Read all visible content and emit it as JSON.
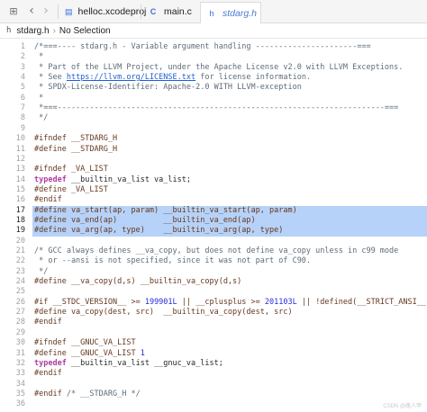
{
  "tabs": [
    {
      "label": "helloc.xcodeproj",
      "icon": "xcodeproj-icon",
      "glyph": "▤"
    },
    {
      "label": "main.c",
      "icon": "c-file-icon",
      "glyph": "C"
    },
    {
      "label": "stdarg.h",
      "icon": "h-file-icon",
      "glyph": "h",
      "active": true
    }
  ],
  "jumpbar": {
    "file": "stdarg.h",
    "file_glyph": "h",
    "item": "No Selection"
  },
  "editor": {
    "highlighted_lines": [
      17,
      18,
      19
    ],
    "current_line": 17,
    "lines": [
      {
        "n": "1",
        "tokens": [
          [
            "c",
            "/*===---- stdarg.h - Variable argument handling ----------------------==="
          ]
        ]
      },
      {
        "n": "2",
        "tokens": [
          [
            "c",
            " *"
          ]
        ]
      },
      {
        "n": "3",
        "tokens": [
          [
            "c",
            " * Part of the LLVM Project, under the Apache License v2.0 with LLVM Exceptions."
          ]
        ]
      },
      {
        "n": "4",
        "tokens": [
          [
            "c",
            " * See "
          ],
          [
            "l",
            "https://llvm.org/LICENSE.txt"
          ],
          [
            "c",
            " for license information."
          ]
        ]
      },
      {
        "n": "5",
        "tokens": [
          [
            "c",
            " * SPDX-License-Identifier: Apache-2.0 WITH LLVM-exception"
          ]
        ]
      },
      {
        "n": "6",
        "tokens": [
          [
            "c",
            " *"
          ]
        ]
      },
      {
        "n": "7",
        "tokens": [
          [
            "c",
            " *===-----------------------------------------------------------------------==="
          ]
        ]
      },
      {
        "n": "8",
        "tokens": [
          [
            "c",
            " */"
          ]
        ]
      },
      {
        "n": "9",
        "tokens": []
      },
      {
        "n": "10",
        "tokens": [
          [
            "p",
            "#ifndef __STDARG_H"
          ]
        ]
      },
      {
        "n": "11",
        "tokens": [
          [
            "p",
            "#define __STDARG_H"
          ]
        ]
      },
      {
        "n": "12",
        "tokens": []
      },
      {
        "n": "13",
        "tokens": [
          [
            "p",
            "#ifndef _VA_LIST"
          ]
        ]
      },
      {
        "n": "14",
        "tokens": [
          [
            "k",
            "typedef"
          ],
          [
            "t",
            " __builtin_va_list va_list;"
          ]
        ]
      },
      {
        "n": "15",
        "tokens": [
          [
            "p",
            "#define _VA_LIST"
          ]
        ]
      },
      {
        "n": "16",
        "tokens": [
          [
            "p",
            "#endif"
          ]
        ]
      },
      {
        "n": "17",
        "tokens": [
          [
            "p",
            "#define va_start(ap, param) __builtin_va_start(ap, param)"
          ]
        ]
      },
      {
        "n": "18",
        "tokens": [
          [
            "p",
            "#define va_end(ap)          __builtin_va_end(ap)"
          ]
        ]
      },
      {
        "n": "19",
        "tokens": [
          [
            "p",
            "#define va_arg(ap, type)    __builtin_va_arg(ap, type)"
          ]
        ]
      },
      {
        "n": "20",
        "tokens": []
      },
      {
        "n": "21",
        "tokens": [
          [
            "c",
            "/* GCC always defines __va_copy, but does not define va_copy unless in c99 mode"
          ]
        ]
      },
      {
        "n": "22",
        "tokens": [
          [
            "c",
            " * or --ansi is not specified, since it was not part of C90."
          ]
        ]
      },
      {
        "n": "23",
        "tokens": [
          [
            "c",
            " */"
          ]
        ]
      },
      {
        "n": "24",
        "tokens": [
          [
            "p",
            "#define __va_copy(d,s) __builtin_va_copy(d,s)"
          ]
        ]
      },
      {
        "n": "25",
        "tokens": []
      },
      {
        "n": "26",
        "tokens": [
          [
            "p",
            "#if __STDC_VERSION__ >= "
          ],
          [
            "n",
            "199901L"
          ],
          [
            "p",
            " || __cplusplus >= "
          ],
          [
            "n",
            "201103L"
          ],
          [
            "p",
            " || !defined(__STRICT_ANSI__)"
          ]
        ]
      },
      {
        "n": "27",
        "tokens": [
          [
            "p",
            "#define va_copy(dest, src)  __builtin_va_copy(dest, src)"
          ]
        ]
      },
      {
        "n": "28",
        "tokens": [
          [
            "p",
            "#endif"
          ]
        ]
      },
      {
        "n": "29",
        "tokens": []
      },
      {
        "n": "30",
        "tokens": [
          [
            "p",
            "#ifndef __GNUC_VA_LIST"
          ]
        ]
      },
      {
        "n": "31",
        "tokens": [
          [
            "p",
            "#define __GNUC_VA_LIST "
          ],
          [
            "n",
            "1"
          ]
        ]
      },
      {
        "n": "32",
        "tokens": [
          [
            "k",
            "typedef"
          ],
          [
            "t",
            " __builtin_va_list __gnuc_va_list;"
          ]
        ]
      },
      {
        "n": "33",
        "tokens": [
          [
            "p",
            "#endif"
          ]
        ]
      },
      {
        "n": "34",
        "tokens": []
      },
      {
        "n": "35",
        "tokens": [
          [
            "p",
            "#endif "
          ],
          [
            "c",
            "/* __STDARG_H */"
          ]
        ]
      },
      {
        "n": "36",
        "tokens": []
      }
    ]
  },
  "watermark": "CSDN @路人甲"
}
